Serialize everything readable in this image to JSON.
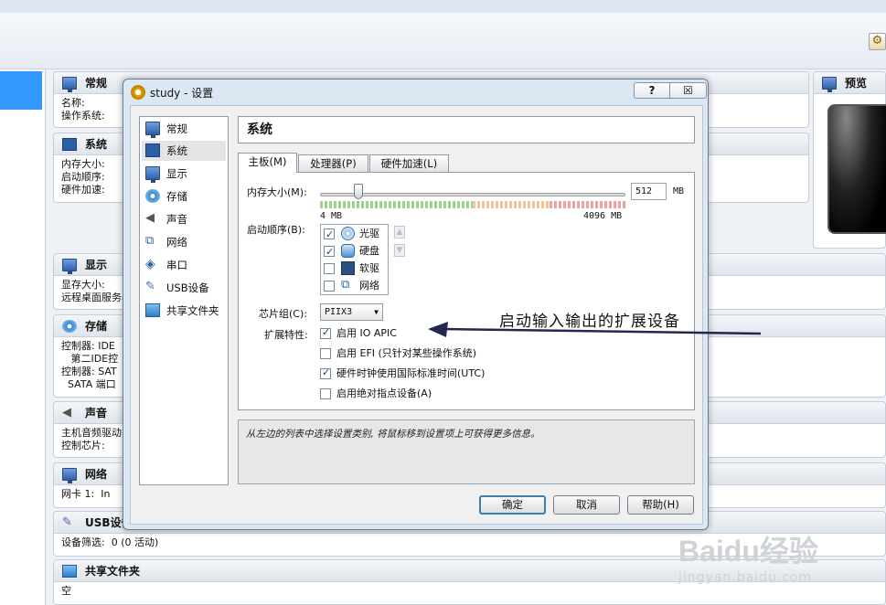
{
  "main": {
    "sections": {
      "general": {
        "title": "常规",
        "lines": "名称:\n操作系统:"
      },
      "system": {
        "title": "系统",
        "lines": "内存大小:\n启动顺序:\n硬件加速:"
      },
      "display": {
        "title": "显示",
        "lines": "显存大小:\n远程桌面服务器"
      },
      "storage": {
        "title": "存储",
        "lines": "控制器: IDE\n   第二IDE控\n控制器: SAT\n  SATA 端口"
      },
      "audio": {
        "title": "声音",
        "lines": "主机音频驱动\n控制芯片:"
      },
      "network": {
        "title": "网络",
        "lines": "网卡 1:  In"
      },
      "usb": {
        "title": "USB设备",
        "lines": "设备筛选:  0 (0 活动)"
      },
      "shared": {
        "title": "共享文件夹",
        "lines": "空"
      },
      "preview": {
        "title": "预览"
      }
    }
  },
  "dialog": {
    "title": "study - 设置",
    "help_btn": "?",
    "close_btn": "☒",
    "categories": [
      {
        "label": "常规",
        "icon": "general-icon"
      },
      {
        "label": "系统",
        "icon": "system-icon"
      },
      {
        "label": "显示",
        "icon": "display-icon"
      },
      {
        "label": "存储",
        "icon": "storage-icon"
      },
      {
        "label": "声音",
        "icon": "audio-icon"
      },
      {
        "label": "网络",
        "icon": "network-icon"
      },
      {
        "label": "串口",
        "icon": "serial-port-icon"
      },
      {
        "label": "USB设备",
        "icon": "usb-icon"
      },
      {
        "label": "共享文件夹",
        "icon": "shared-folder-icon"
      }
    ],
    "selected_category": "系统",
    "page_title": "系统",
    "tabs": [
      "主板(M)",
      "处理器(P)",
      "硬件加速(L)"
    ],
    "motherboard": {
      "memory_label": "内存大小(M):",
      "memory_value": "512",
      "memory_unit": "MB",
      "slider_fraction": 0.126,
      "scale_min": "4  MB",
      "scale_max": "4096  MB",
      "boot_label": "启动顺序(B):",
      "boot_items": [
        {
          "label": "光驱",
          "checked": true,
          "icon": "optical-drive-icon"
        },
        {
          "label": "硬盘",
          "checked": true,
          "icon": "hard-disk-icon"
        },
        {
          "label": "软驱",
          "checked": false,
          "icon": "floppy-icon"
        },
        {
          "label": "网络",
          "checked": false,
          "icon": "network-boot-icon"
        }
      ],
      "chipset_label": "芯片组(C):",
      "chipset_value": "PIIX3",
      "ext_label": "扩展特性:",
      "features": [
        {
          "label": "启用 IO APIC",
          "checked": true
        },
        {
          "label": "启用 EFI (只针对某些操作系统)",
          "checked": false
        },
        {
          "label": "硬件时钟使用国际标准时间(UTC)",
          "checked": true
        },
        {
          "label": "启用绝对指点设备(A)",
          "checked": false
        }
      ]
    },
    "info_text": "从左边的列表中选择设置类别, 将鼠标移到设置项上可获得更多信息。",
    "buttons": {
      "ok": "确定",
      "cancel": "取消",
      "help": "帮助(H)"
    }
  },
  "annotation": "启动输入输出的扩展设备",
  "watermark": {
    "brand": "Baidu经验",
    "url": "jingyan.baidu.com"
  }
}
